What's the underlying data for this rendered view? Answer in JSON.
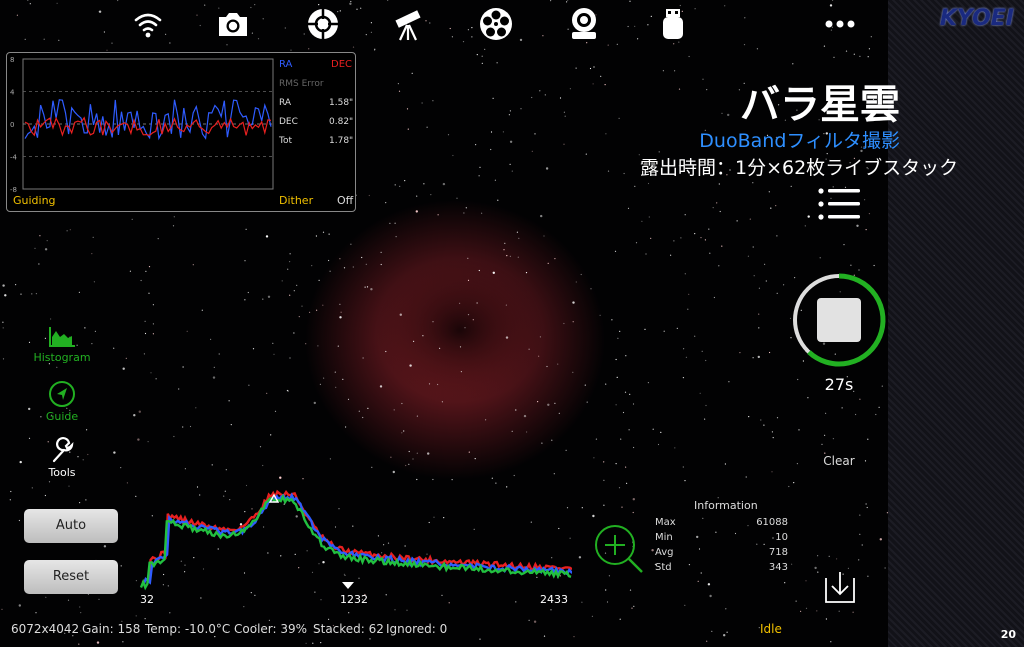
{
  "toolbar": {
    "icons": [
      "wifi-icon",
      "camera-icon",
      "crosshair-icon",
      "telescope-icon",
      "filter-wheel-icon",
      "focuser-icon",
      "usb-drive-icon",
      "more-icon"
    ]
  },
  "brand": "KYOEI",
  "page_number": "20",
  "guide_panel": {
    "y_ticks": [
      "8",
      "4",
      "0",
      "-4",
      "-8"
    ],
    "ra_label": "RA",
    "dec_label": "DEC",
    "rms_title": "RMS Error",
    "rows": [
      {
        "label": "RA",
        "value": "1.58\""
      },
      {
        "label": "DEC",
        "value": "0.82\""
      },
      {
        "label": "Tot",
        "value": "1.78\""
      }
    ],
    "guiding_label": "Guiding",
    "dither_label": "Dither",
    "dither_value": "Off",
    "colors": {
      "ra": "#2f5cff",
      "dec": "#e82020"
    }
  },
  "overlay": {
    "title": "バラ星雲",
    "subtitle": "DuoBandフィルタ撮影",
    "exposure": "露出時間：1分×62枚ライブスタック"
  },
  "left_tools": [
    {
      "label": "Histogram",
      "icon": "histogram-icon",
      "color": "#22b022"
    },
    {
      "label": "Guide",
      "icon": "guide-compass-icon",
      "color": "#22b022"
    },
    {
      "label": "Tools",
      "icon": "wrench-icon",
      "color": "#ffffff"
    }
  ],
  "buttons": {
    "auto": "Auto",
    "reset": "Reset"
  },
  "histogram": {
    "left_label": "32",
    "mid_label": "1232",
    "right_label": "2433"
  },
  "information": {
    "title": "Information",
    "rows": [
      {
        "label": "Max",
        "value": "61088"
      },
      {
        "label": "Min",
        "value": "10"
      },
      {
        "label": "Avg",
        "value": "718"
      },
      {
        "label": "Std",
        "value": "343"
      }
    ]
  },
  "capture": {
    "countdown": "27s",
    "progress": 0.62,
    "clear_label": "Clear"
  },
  "status_bar": {
    "resolution": "6072x4042",
    "gain": "Gain: 158",
    "temp": "Temp: -10.0°C",
    "cooler": "Cooler: 39%",
    "stacked": "Stacked: 62",
    "ignored": "Ignored: 0",
    "state": "Idle",
    "state_color": "#f0c000"
  }
}
